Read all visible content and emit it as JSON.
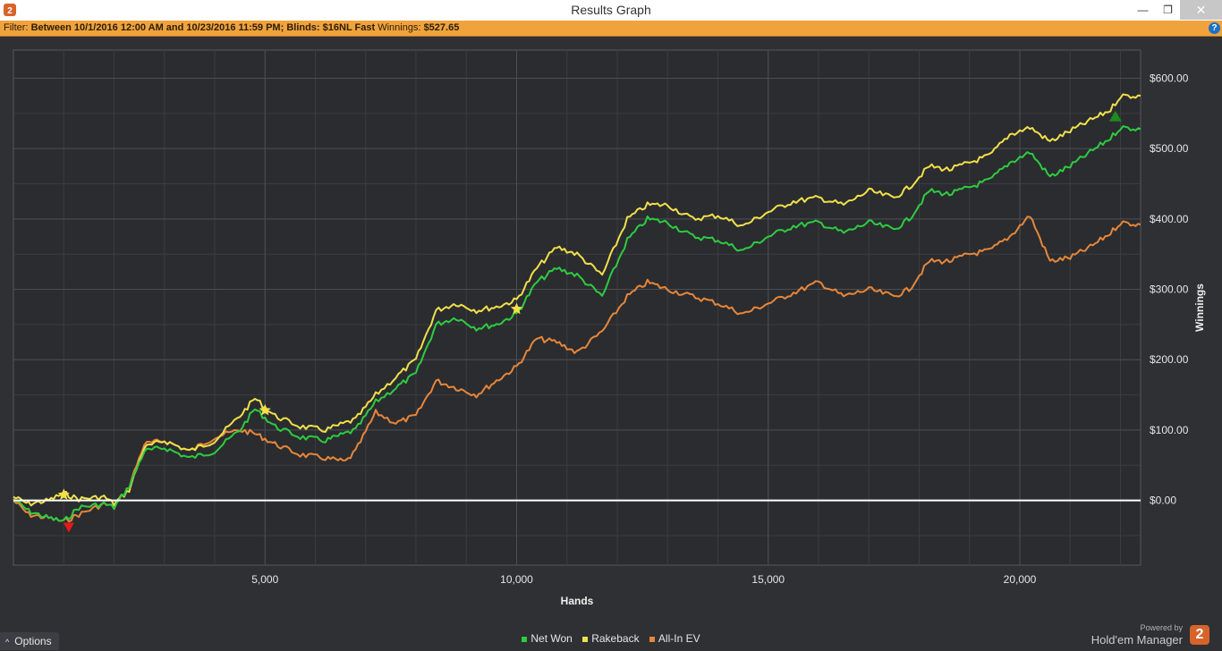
{
  "window": {
    "title": "Results Graph",
    "minimize_glyph": "—",
    "maximize_glyph": "❐",
    "close_glyph": "✕"
  },
  "filter": {
    "prefix": "Filter:",
    "main": "Between 10/1/2016 12:00 AM and 10/23/2016 11:59 PM; Blinds: $16NL Fast",
    "winnings_label": "Winnings:",
    "winnings_value": "$527.65",
    "help_glyph": "?"
  },
  "legend": [
    {
      "name": "Net Won",
      "color": "#2ecc40"
    },
    {
      "name": "Rakeback",
      "color": "#f2e04a"
    },
    {
      "name": "All-In EV",
      "color": "#e8863a"
    }
  ],
  "options": {
    "label": "Options",
    "chevron": "^"
  },
  "brand": {
    "powered": "Powered by",
    "name": "Hold'em Manager",
    "logo": "2"
  },
  "chart_data": {
    "type": "line",
    "xlabel": "Hands",
    "ylabel": "Winnings",
    "xlim": [
      0,
      22400
    ],
    "ylim": [
      -92,
      640
    ],
    "x_ticks": [
      5000,
      10000,
      15000,
      20000
    ],
    "x_tick_labels": [
      "5,000",
      "10,000",
      "15,000",
      "20,000"
    ],
    "y_ticks": [
      0,
      100,
      200,
      300,
      400,
      500,
      600
    ],
    "y_tick_labels": [
      "$0.00",
      "$100.00",
      "$200.00",
      "$300.00",
      "$400.00",
      "$500.00",
      "$600.00"
    ],
    "grid": true,
    "legend_position": "bottom-center",
    "series": [
      {
        "name": "Rakeback",
        "color": "#f2e04a",
        "x": [
          0,
          300,
          700,
          1000,
          1300,
          1800,
          2000,
          2300,
          2600,
          3000,
          3500,
          4000,
          4500,
          4800,
          5200,
          5700,
          6200,
          6600,
          6800,
          7200,
          7600,
          8000,
          8400,
          8800,
          9200,
          9600,
          10000,
          10400,
          10800,
          11200,
          11700,
          12200,
          12600,
          13000,
          13500,
          14000,
          14500,
          15000,
          15500,
          16000,
          16500,
          17000,
          17500,
          17800,
          18200,
          18600,
          19000,
          19400,
          19800,
          20200,
          20600,
          21000,
          21400,
          21800,
          22000,
          22400
        ],
        "y": [
          5,
          -5,
          0,
          10,
          2,
          5,
          -5,
          15,
          75,
          85,
          70,
          85,
          120,
          145,
          120,
          105,
          100,
          110,
          115,
          150,
          175,
          200,
          270,
          280,
          270,
          275,
          285,
          330,
          360,
          350,
          320,
          400,
          420,
          420,
          400,
          405,
          390,
          410,
          425,
          430,
          420,
          440,
          430,
          445,
          475,
          470,
          480,
          490,
          520,
          530,
          510,
          525,
          540,
          555,
          575,
          575
        ]
      },
      {
        "name": "Net Won",
        "color": "#2ecc40",
        "x": [
          0,
          300,
          700,
          1000,
          1300,
          1800,
          2000,
          2300,
          2600,
          3000,
          3500,
          4000,
          4500,
          4800,
          5200,
          5700,
          6200,
          6600,
          6800,
          7200,
          7600,
          8000,
          8400,
          8800,
          9200,
          9600,
          10000,
          10400,
          10800,
          11200,
          11700,
          12200,
          12600,
          13000,
          13500,
          14000,
          14500,
          15000,
          15500,
          16000,
          16500,
          17000,
          17500,
          17800,
          18200,
          18600,
          19000,
          19400,
          19800,
          20200,
          20600,
          21000,
          21400,
          21800,
          22000,
          22400
        ],
        "y": [
          2,
          -15,
          -25,
          -30,
          -10,
          -5,
          -10,
          20,
          70,
          75,
          60,
          70,
          100,
          130,
          105,
          90,
          85,
          95,
          100,
          140,
          160,
          180,
          250,
          260,
          245,
          250,
          265,
          310,
          330,
          320,
          290,
          370,
          400,
          395,
          375,
          370,
          355,
          375,
          390,
          395,
          380,
          395,
          385,
          400,
          440,
          435,
          445,
          455,
          480,
          495,
          460,
          475,
          495,
          515,
          530,
          528
        ]
      },
      {
        "name": "All-In EV",
        "color": "#e8863a",
        "x": [
          0,
          300,
          700,
          1000,
          1300,
          1800,
          2000,
          2300,
          2600,
          3000,
          3500,
          4000,
          4500,
          4800,
          5200,
          5700,
          6200,
          6600,
          6800,
          7200,
          7600,
          8000,
          8400,
          8800,
          9200,
          9600,
          10000,
          10400,
          10800,
          11200,
          11700,
          12200,
          12600,
          13000,
          13500,
          14000,
          14500,
          15000,
          15500,
          16000,
          16500,
          17000,
          17500,
          17800,
          18200,
          18600,
          19000,
          19400,
          19800,
          20200,
          20600,
          21000,
          21400,
          21800,
          22000,
          22400
        ],
        "y": [
          0,
          -20,
          -25,
          -30,
          -20,
          -5,
          -10,
          20,
          80,
          85,
          70,
          90,
          100,
          95,
          80,
          65,
          60,
          55,
          70,
          125,
          110,
          120,
          170,
          160,
          150,
          170,
          190,
          230,
          225,
          210,
          240,
          290,
          310,
          300,
          290,
          280,
          265,
          280,
          295,
          310,
          290,
          300,
          290,
          300,
          340,
          340,
          350,
          355,
          375,
          405,
          340,
          345,
          360,
          380,
          395,
          392
        ]
      }
    ],
    "markers": [
      {
        "type": "star",
        "x": 1000,
        "y": 8,
        "color": "#f2e04a"
      },
      {
        "type": "star",
        "x": 5000,
        "y": 128,
        "color": "#f2e04a"
      },
      {
        "type": "star",
        "x": 10000,
        "y": 272,
        "color": "#f2e04a"
      },
      {
        "type": "down-triangle",
        "x": 1100,
        "y": -38,
        "color": "#e01b1b"
      },
      {
        "type": "up-triangle",
        "x": 21900,
        "y": 545,
        "color": "#1f8a1f"
      }
    ]
  }
}
